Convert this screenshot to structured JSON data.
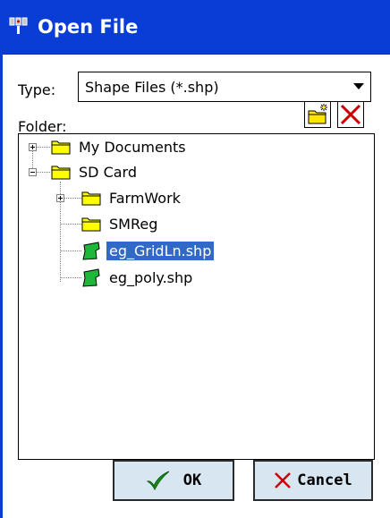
{
  "window": {
    "title": "Open File"
  },
  "type_filter": {
    "label": "Type:",
    "value": "Shape Files (*.shp)"
  },
  "folder": {
    "label": "Folder:"
  },
  "tree": [
    {
      "label": "My Documents",
      "kind": "folder",
      "expander": "plus"
    },
    {
      "label": "SD Card",
      "kind": "folder",
      "expander": "minus"
    },
    {
      "label": "FarmWork",
      "kind": "folder",
      "expander": "plus"
    },
    {
      "label": "SMReg",
      "kind": "folder"
    },
    {
      "label": "eg_GridLn.shp",
      "kind": "shapefile",
      "selected": true
    },
    {
      "label": "eg_poly.shp",
      "kind": "shapefile"
    }
  ],
  "buttons": {
    "ok": "OK",
    "cancel": "Cancel"
  },
  "colors": {
    "titlebar": "#0a3cd6",
    "selection": "#3169c6",
    "button_face": "#d8e6f2",
    "folder_yellow": "#ffff00",
    "shapefile_green": "#1db83a"
  }
}
